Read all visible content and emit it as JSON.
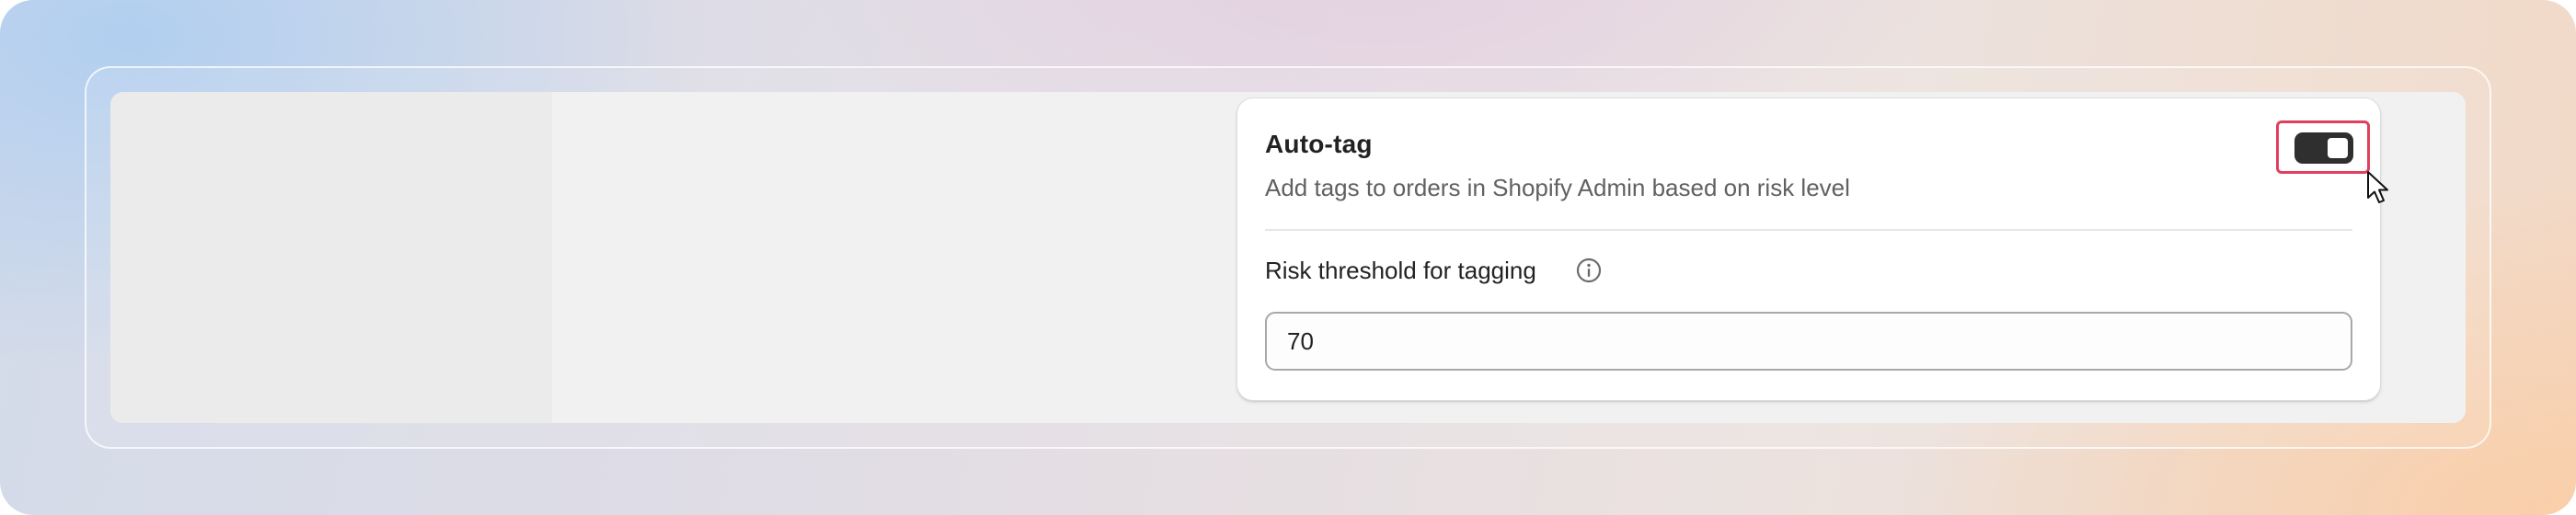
{
  "settings_card": {
    "title": "Auto-tag",
    "description": "Add tags to orders in Shopify Admin based on risk level",
    "toggle": {
      "state": "on"
    },
    "threshold": {
      "label": "Risk threshold for tagging",
      "value": "70",
      "info_icon": "info-circle-icon"
    }
  },
  "colors": {
    "highlight": "#e0405e",
    "toggle_on": "#2f2f2f"
  }
}
